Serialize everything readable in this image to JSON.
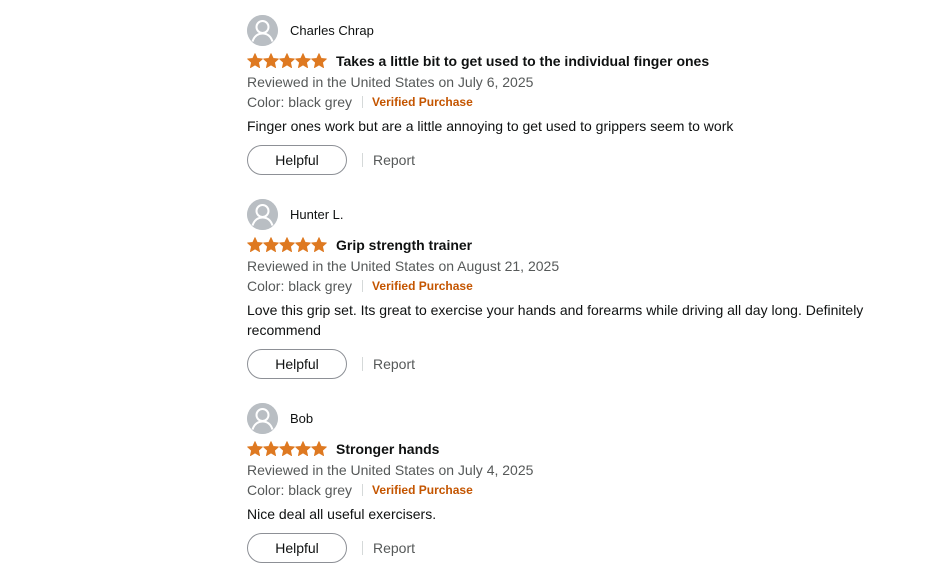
{
  "colors": {
    "star": "#de7921",
    "verified": "#c45500",
    "meta_text": "#565959",
    "avatar_bg": "#b9bec3"
  },
  "reviews": [
    {
      "author": "Charles Chrap",
      "rating": 5,
      "rating_max": 5,
      "title": "Takes a little bit to get used to the individual finger ones",
      "date": "Reviewed in the United States on July 6, 2025",
      "color": "Color: black grey",
      "verified": "Verified Purchase",
      "body": "Finger ones work but are a little annoying to get used to grippers seem to work",
      "helpful_label": "Helpful",
      "report_label": "Report"
    },
    {
      "author": "Hunter L.",
      "rating": 5,
      "rating_max": 5,
      "title": "Grip strength trainer",
      "date": "Reviewed in the United States on August 21, 2025",
      "color": "Color: black grey",
      "verified": "Verified Purchase",
      "body": "Love this grip set. Its great to exercise your hands and forearms while driving all day long. Definitely recommend",
      "helpful_label": "Helpful",
      "report_label": "Report"
    },
    {
      "author": "Bob",
      "rating": 5,
      "rating_max": 5,
      "title": "Stronger hands",
      "date": "Reviewed in the United States on July 4, 2025",
      "color": "Color: black grey",
      "verified": "Verified Purchase",
      "body": "Nice deal all useful exercisers.",
      "helpful_label": "Helpful",
      "report_label": "Report"
    }
  ]
}
